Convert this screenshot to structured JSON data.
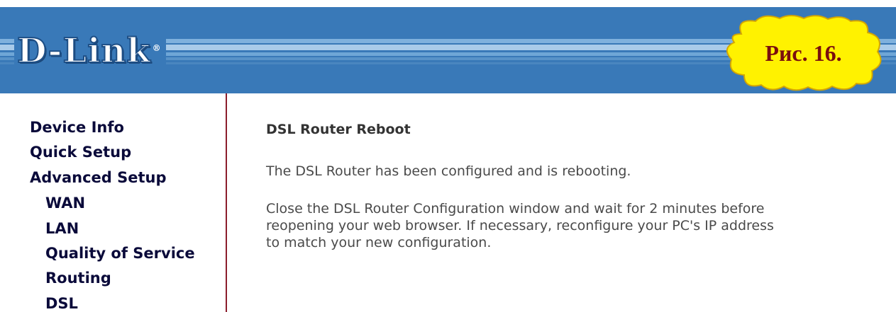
{
  "header": {
    "logo_text": "D-Link",
    "logo_mark": "®",
    "callout_text": "Рис. 16."
  },
  "sidebar": {
    "items": [
      {
        "label": "Device Info"
      },
      {
        "label": "Quick Setup"
      },
      {
        "label": "Advanced Setup"
      },
      {
        "label": "WAN"
      },
      {
        "label": "LAN"
      },
      {
        "label": "Quality of Service"
      },
      {
        "label": "Routing"
      },
      {
        "label": "DSL"
      }
    ]
  },
  "main": {
    "title": "DSL Router Reboot",
    "message": "The DSL Router has been configured and is rebooting.",
    "instructions_lines": [
      "Close the DSL Router Configuration window and wait for 2 minutes before",
      "reopening your web browser. If necessary, reconfigure your PC's IP address",
      "to match your new configuration."
    ]
  },
  "colors": {
    "banner": "#3979b8",
    "sidebar_border": "#8b1d2c",
    "nav_text": "#0a0a3a",
    "callout_fill": "#fff200",
    "callout_text": "#7a0e0e"
  }
}
